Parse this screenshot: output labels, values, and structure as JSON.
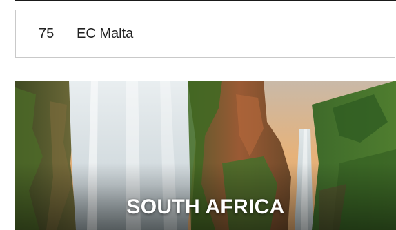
{
  "list": {
    "rank": "75",
    "name": "EC Malta"
  },
  "destination_card": {
    "title": "SOUTH AFRICA",
    "image": "waterfall-landscape-photo"
  },
  "colors": {
    "text": "#222222",
    "border": "#c9c9c9",
    "card_title": "#ffffff"
  }
}
